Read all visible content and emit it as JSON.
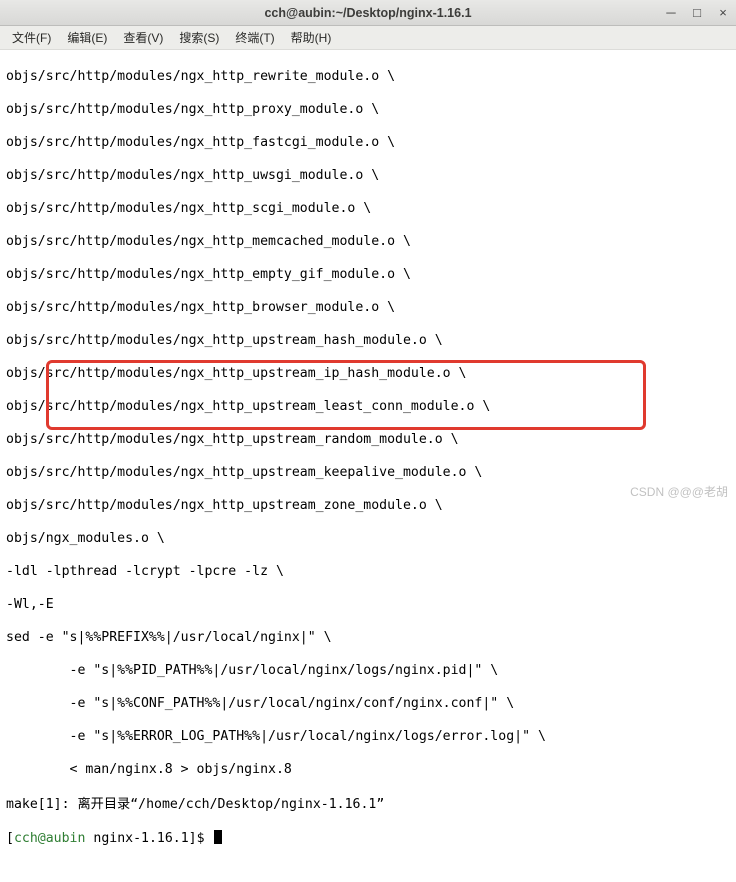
{
  "titlebar": {
    "title": "cch@aubin:~/Desktop/nginx-1.16.1"
  },
  "menu": {
    "file": "文件(F)",
    "edit": "编辑(E)",
    "view": "查看(V)",
    "search": "搜索(S)",
    "term": "终端(T)",
    "help": "帮助(H)"
  },
  "terminal": {
    "l1": "objs/src/http/modules/ngx_http_rewrite_module.o \\",
    "l2": "objs/src/http/modules/ngx_http_proxy_module.o \\",
    "l3": "objs/src/http/modules/ngx_http_fastcgi_module.o \\",
    "l4": "objs/src/http/modules/ngx_http_uwsgi_module.o \\",
    "l5": "objs/src/http/modules/ngx_http_scgi_module.o \\",
    "l6": "objs/src/http/modules/ngx_http_memcached_module.o \\",
    "l7": "objs/src/http/modules/ngx_http_empty_gif_module.o \\",
    "l8": "objs/src/http/modules/ngx_http_browser_module.o \\",
    "l9": "objs/src/http/modules/ngx_http_upstream_hash_module.o \\",
    "l10": "objs/src/http/modules/ngx_http_upstream_ip_hash_module.o \\",
    "l11": "objs/src/http/modules/ngx_http_upstream_least_conn_module.o \\",
    "l12": "objs/src/http/modules/ngx_http_upstream_random_module.o \\",
    "l13": "objs/src/http/modules/ngx_http_upstream_keepalive_module.o \\",
    "l14": "objs/src/http/modules/ngx_http_upstream_zone_module.o \\",
    "l15": "objs/ngx_modules.o \\",
    "l16": "-ldl -lpthread -lcrypt -lpcre -lz \\",
    "l17": "-Wl,-E",
    "l18": "sed -e \"s|%%PREFIX%%|/usr/local/nginx|\" \\",
    "l19": "        -e \"s|%%PID_PATH%%|/usr/local/nginx/logs/nginx.pid|\" \\",
    "l20": "        -e \"s|%%CONF_PATH%%|/usr/local/nginx/conf/nginx.conf|\" \\",
    "l21": "        -e \"s|%%ERROR_LOG_PATH%%|/usr/local/nginx/logs/error.log|\" \\",
    "l22": "        < man/nginx.8 > objs/nginx.8",
    "l23": "make[1]: 离开目录“/home/cch/Desktop/nginx-1.16.1”",
    "prompt_user": "cch@aubin",
    "prompt_path": "nginx-1.16.1",
    "prompt_left": "[",
    "prompt_right": "]$ "
  },
  "watermark": "CSDN @@@老胡"
}
